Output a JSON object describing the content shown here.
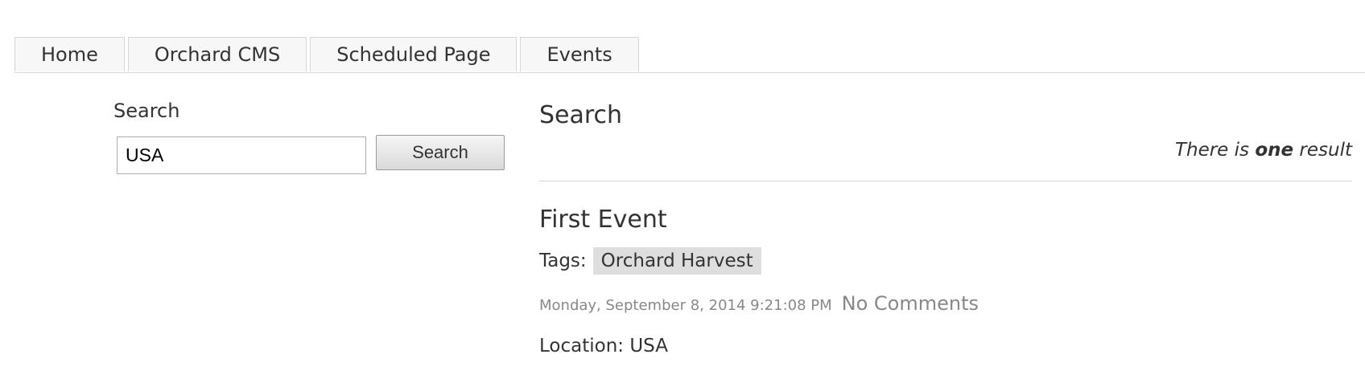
{
  "nav": {
    "tabs": [
      {
        "label": "Home"
      },
      {
        "label": "Orchard CMS"
      },
      {
        "label": "Scheduled Page"
      },
      {
        "label": "Events"
      }
    ]
  },
  "search_widget": {
    "label": "Search",
    "input_value": "USA",
    "button_label": "Search"
  },
  "results": {
    "title": "Search",
    "summary_prefix": "There is",
    "summary_count": "one",
    "summary_suffix": "result",
    "items": [
      {
        "title": "First Event",
        "tags_label": "Tags:",
        "tags": [
          "Orchard Harvest"
        ],
        "date": "Monday, September 8, 2014 9:21:08 PM",
        "comments": "No Comments",
        "location": "Location: USA"
      }
    ]
  }
}
